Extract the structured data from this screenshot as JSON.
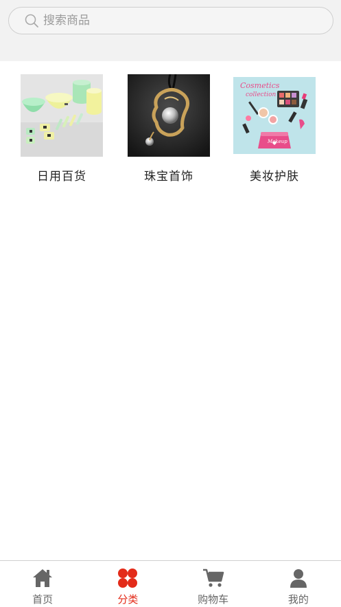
{
  "search": {
    "placeholder": "搜索商品"
  },
  "categories": [
    {
      "label": "日用百货",
      "icon": "daily-goods-image"
    },
    {
      "label": "珠宝首饰",
      "icon": "jewelry-image"
    },
    {
      "label": "美妆护肤",
      "icon": "cosmetics-image"
    }
  ],
  "tabbar": {
    "active": "分类",
    "active_color": "#e32b19",
    "inactive_color": "#666666",
    "items": [
      {
        "label": "首页",
        "icon": "home-icon"
      },
      {
        "label": "分类",
        "icon": "category-icon"
      },
      {
        "label": "购物车",
        "icon": "cart-icon"
      },
      {
        "label": "我的",
        "icon": "profile-icon"
      }
    ]
  },
  "cosmetics_image_text": {
    "line1": "Cosmetics",
    "line2": "collection",
    "bag": "Makeup"
  }
}
